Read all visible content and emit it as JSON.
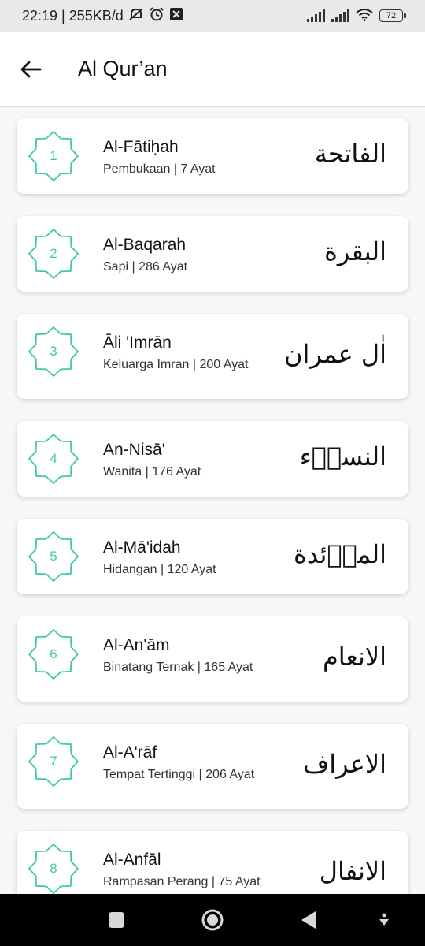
{
  "status_bar": {
    "time_speed": "22:19 | 255KB/d",
    "battery": "72",
    "icons": [
      "mute-bell-icon",
      "alarm-icon",
      "box-x-icon",
      "signal-icon",
      "signal-icon",
      "wifi-icon",
      "battery-icon"
    ]
  },
  "app_bar": {
    "title": "Al Qur’an",
    "back_icon": "arrow-left-icon"
  },
  "colors": {
    "accent": "#3fc7ad",
    "card_bg": "#ffffff",
    "page_bg": "#f7f7f7"
  },
  "surahs": [
    {
      "number": "1",
      "name": "Al-Fātiḥah",
      "meta": "Pembukaan | 7 Ayat",
      "arabic": "الفاتحة"
    },
    {
      "number": "2",
      "name": "Al-Baqarah",
      "meta": "Sapi | 286 Ayat",
      "arabic": "البقرة"
    },
    {
      "number": "3",
      "name": "Āli 'Imrān",
      "meta": "Keluarga Imran | 200 Ayat",
      "arabic": "اٰل عمران"
    },
    {
      "number": "4",
      "name": "An-Nisā'",
      "meta": "Wanita | 176 Ayat",
      "arabic": "النساۤء"
    },
    {
      "number": "5",
      "name": "Al-Mā'idah",
      "meta": "Hidangan | 120 Ayat",
      "arabic": "الماۤئدة"
    },
    {
      "number": "6",
      "name": "Al-An'ām",
      "meta": "Binatang Ternak | 165 Ayat",
      "arabic": "الانعام"
    },
    {
      "number": "7",
      "name": "Al-A'rāf",
      "meta": "Tempat Tertinggi | 206 Ayat",
      "arabic": "الاعراف"
    },
    {
      "number": "8",
      "name": "Al-Anfāl",
      "meta": "Rampasan Perang | 75 Ayat",
      "arabic": "الانفال"
    }
  ],
  "nav_bar": {
    "icons": [
      "square-recents-icon",
      "circle-home-icon",
      "triangle-back-icon",
      "accessibility-icon"
    ]
  }
}
